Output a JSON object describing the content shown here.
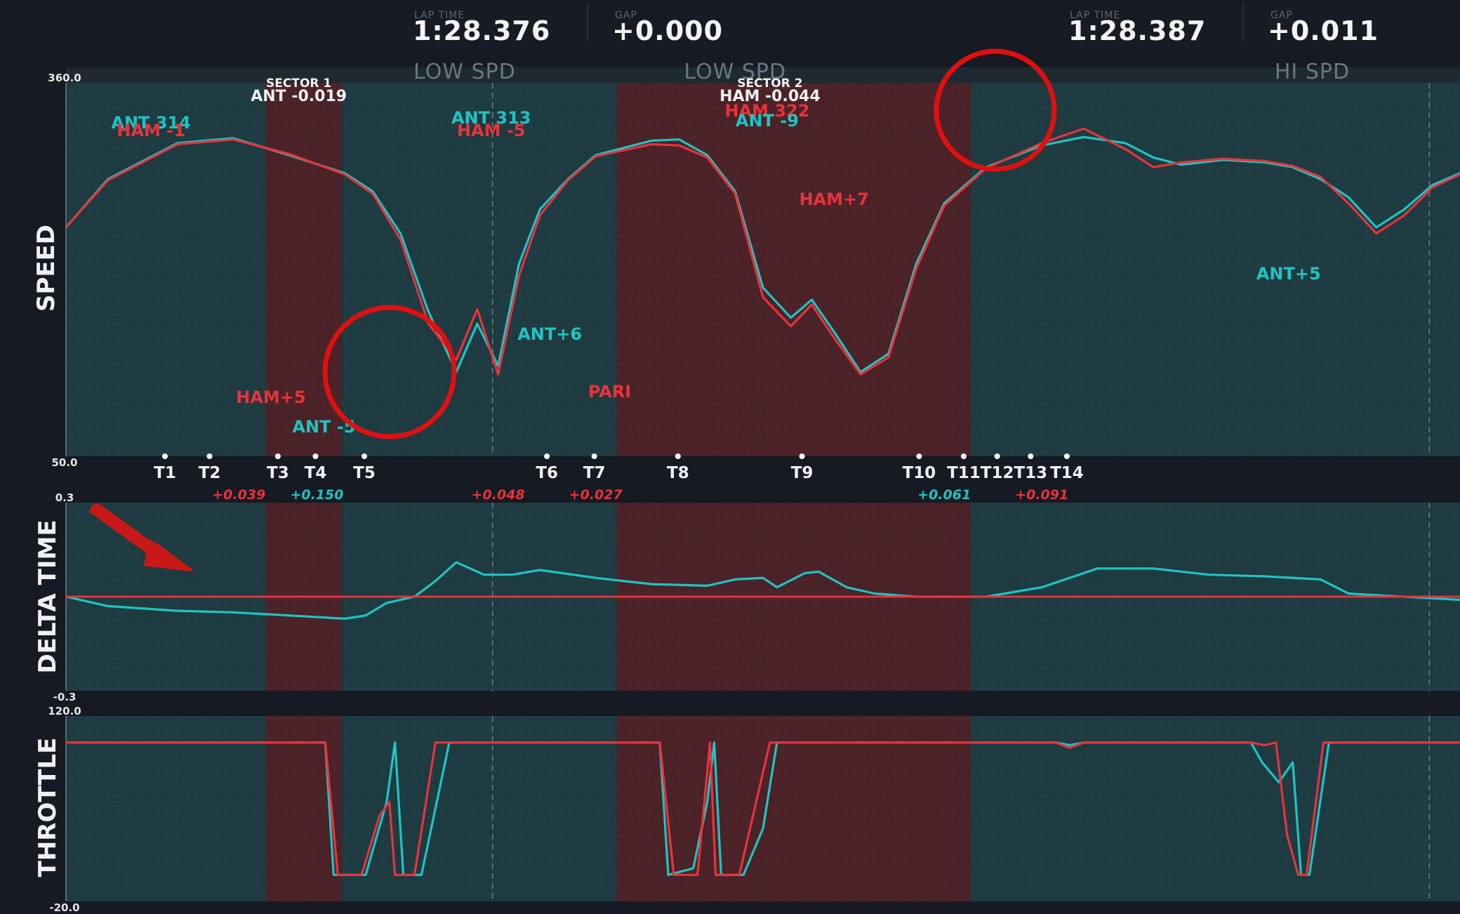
{
  "header": {
    "car1": {
      "lap_time_caption": "LAP TIME",
      "lap_time": "1:28.376",
      "gap_caption": "GAP",
      "gap": "+0.000"
    },
    "car2": {
      "lap_time_caption": "LAP TIME",
      "lap_time": "1:28.387",
      "gap_caption": "GAP",
      "gap": "+0.011"
    }
  },
  "zones": [
    {
      "label": "LOW SPD"
    },
    {
      "label": "LOW SPD"
    },
    {
      "label": "HI SPD"
    }
  ],
  "sector_labels": [
    {
      "title": "SECTOR 1",
      "value": "ANT -0.019"
    },
    {
      "title": "SECTOR 2",
      "value": "HAM -0.044"
    }
  ],
  "colors": {
    "ant": "#1fc4c4",
    "ham": "#e8333b",
    "teal_bg": "#1d3b40",
    "red_bg": "#4a2227",
    "circle": "#e01010",
    "arrow": "#c81818"
  },
  "panels": {
    "speed": {
      "label": "SPEED",
      "ymax_label": "360.0",
      "ymin_label": "50.0"
    },
    "delta": {
      "label": "DELTA TIME",
      "ymax_label": "0.3",
      "ymin_label": "-0.3"
    },
    "throttle": {
      "label": "THROTTLE",
      "ymax_label": "120.0",
      "ymin_label": "-20.0"
    }
  },
  "turns": [
    "T1",
    "T2",
    "T3",
    "T4",
    "T5",
    "T6",
    "T7",
    "T8",
    "T9",
    "T10",
    "T11",
    "T12",
    "T13",
    "T14"
  ],
  "gaps": [
    "+0.039",
    "+0.150",
    "+0.048",
    "+0.027",
    "+0.061",
    "+0.091"
  ],
  "annotations": [
    {
      "text": "ANT 314",
      "color": "ant"
    },
    {
      "text": "HAM -1",
      "color": "ham"
    },
    {
      "text": "ANT 313",
      "color": "ant"
    },
    {
      "text": "HAM -5",
      "color": "ham"
    },
    {
      "text": "HAM 322",
      "color": "ham"
    },
    {
      "text": "ANT -9",
      "color": "ant"
    },
    {
      "text": "HAM+7",
      "color": "ham"
    },
    {
      "text": "HAM+5",
      "color": "ham"
    },
    {
      "text": "ANT -5",
      "color": "ant"
    },
    {
      "text": "ANT+6",
      "color": "ant"
    },
    {
      "text": "PARI",
      "color": "ham"
    },
    {
      "text": "ANT+5",
      "color": "ant"
    }
  ],
  "chart_data": [
    {
      "type": "line",
      "title": "SPEED",
      "ylim": [
        50,
        360
      ],
      "xlim": [
        0,
        100
      ],
      "series": [
        {
          "name": "ANT",
          "points": [
            [
              0,
              240
            ],
            [
              3,
              280
            ],
            [
              8,
              310
            ],
            [
              12,
              314
            ],
            [
              16,
              300
            ],
            [
              20,
              285
            ],
            [
              22,
              270
            ],
            [
              24,
              235
            ],
            [
              26,
              170
            ],
            [
              28,
              120
            ],
            [
              29.5,
              160
            ],
            [
              31,
              125
            ],
            [
              32.5,
              210
            ],
            [
              34,
              255
            ],
            [
              36,
              280
            ],
            [
              38,
              300
            ],
            [
              42,
              312
            ],
            [
              44,
              313
            ],
            [
              46,
              300
            ],
            [
              48,
              270
            ],
            [
              50,
              190
            ],
            [
              52,
              165
            ],
            [
              53.5,
              180
            ],
            [
              55,
              155
            ],
            [
              57,
              120
            ],
            [
              59,
              135
            ],
            [
              61,
              210
            ],
            [
              63,
              260
            ],
            [
              66,
              290
            ],
            [
              70,
              308
            ],
            [
              73,
              315
            ],
            [
              76,
              310
            ],
            [
              78,
              298
            ],
            [
              80,
              292
            ],
            [
              83,
              296
            ],
            [
              86,
              294
            ],
            [
              88,
              290
            ],
            [
              90,
              280
            ],
            [
              92,
              265
            ],
            [
              94,
              240
            ],
            [
              96,
              255
            ],
            [
              98,
              275
            ],
            [
              100,
              285
            ]
          ]
        },
        {
          "name": "HAM",
          "points": [
            [
              0,
              240
            ],
            [
              3,
              279
            ],
            [
              8,
              309
            ],
            [
              12,
              313
            ],
            [
              16,
              301
            ],
            [
              20,
              284
            ],
            [
              22,
              268
            ],
            [
              24,
              230
            ],
            [
              26,
              160
            ],
            [
              28,
              130
            ],
            [
              29.5,
              172
            ],
            [
              31,
              118
            ],
            [
              32.5,
              200
            ],
            [
              34,
              250
            ],
            [
              36,
              279
            ],
            [
              38,
              299
            ],
            [
              42,
              309
            ],
            [
              44,
              308
            ],
            [
              46,
              298
            ],
            [
              48,
              268
            ],
            [
              50,
              182
            ],
            [
              52,
              158
            ],
            [
              53.5,
              176
            ],
            [
              55,
              150
            ],
            [
              57,
              118
            ],
            [
              59,
              132
            ],
            [
              61,
              206
            ],
            [
              63,
              258
            ],
            [
              66,
              289
            ],
            [
              70,
              310
            ],
            [
              73,
              322
            ],
            [
              76,
              305
            ],
            [
              78,
              290
            ],
            [
              80,
              294
            ],
            [
              83,
              297
            ],
            [
              86,
              295
            ],
            [
              88,
              291
            ],
            [
              90,
              282
            ],
            [
              92,
              260
            ],
            [
              94,
              235
            ],
            [
              96,
              250
            ],
            [
              98,
              273
            ],
            [
              100,
              284
            ]
          ]
        }
      ]
    },
    {
      "type": "line",
      "title": "DELTA TIME",
      "ylim": [
        -0.3,
        0.3
      ],
      "xlim": [
        0,
        100
      ],
      "series": [
        {
          "name": "ANT",
          "points": [
            [
              0,
              0
            ],
            [
              3,
              -0.03
            ],
            [
              8,
              -0.045
            ],
            [
              12,
              -0.05
            ],
            [
              18,
              -0.065
            ],
            [
              20,
              -0.07
            ],
            [
              21.5,
              -0.06
            ],
            [
              23,
              -0.02
            ],
            [
              25,
              0.0
            ],
            [
              26.5,
              0.05
            ],
            [
              28,
              0.11
            ],
            [
              29,
              0.09
            ],
            [
              30,
              0.07
            ],
            [
              32,
              0.07
            ],
            [
              34,
              0.085
            ],
            [
              38,
              0.06
            ],
            [
              42,
              0.04
            ],
            [
              46,
              0.035
            ],
            [
              48,
              0.055
            ],
            [
              50,
              0.06
            ],
            [
              51,
              0.03
            ],
            [
              53,
              0.075
            ],
            [
              54,
              0.08
            ],
            [
              56,
              0.03
            ],
            [
              58,
              0.01
            ],
            [
              61,
              0.0
            ],
            [
              66,
              0.0
            ],
            [
              70,
              0.03
            ],
            [
              74,
              0.09
            ],
            [
              78,
              0.09
            ],
            [
              82,
              0.07
            ],
            [
              86,
              0.065
            ],
            [
              90,
              0.055
            ],
            [
              92,
              0.01
            ],
            [
              94,
              0.005
            ],
            [
              100,
              -0.01
            ]
          ]
        },
        {
          "name": "HAM",
          "points": [
            [
              0,
              0
            ],
            [
              100,
              0
            ]
          ]
        }
      ]
    },
    {
      "type": "line",
      "title": "THROTTLE",
      "ylim": [
        -20,
        120
      ],
      "xlim": [
        0,
        100
      ],
      "series": [
        {
          "name": "ANT",
          "points": [
            [
              0,
              100
            ],
            [
              18,
              100
            ],
            [
              18.6,
              100
            ],
            [
              19.2,
              0
            ],
            [
              21.5,
              0
            ],
            [
              23,
              55
            ],
            [
              23.6,
              100
            ],
            [
              24.2,
              0
            ],
            [
              25.5,
              0
            ],
            [
              27.5,
              100
            ],
            [
              42,
              100
            ],
            [
              42.6,
              100
            ],
            [
              43.2,
              0
            ],
            [
              45,
              5
            ],
            [
              46,
              55
            ],
            [
              46.5,
              100
            ],
            [
              47,
              0
            ],
            [
              48.6,
              0
            ],
            [
              50,
              35
            ],
            [
              51,
              100
            ],
            [
              71,
              100
            ],
            [
              72,
              98
            ],
            [
              73,
              100
            ],
            [
              85,
              100
            ],
            [
              85.8,
              85
            ],
            [
              87,
              70
            ],
            [
              88,
              85
            ],
            [
              88.6,
              0
            ],
            [
              89.2,
              0
            ],
            [
              90.6,
              100
            ],
            [
              100,
              100
            ]
          ]
        },
        {
          "name": "HAM",
          "points": [
            [
              0,
              100
            ],
            [
              18,
              100
            ],
            [
              18.6,
              100
            ],
            [
              19.5,
              0
            ],
            [
              21.2,
              0
            ],
            [
              22.5,
              45
            ],
            [
              23.2,
              55
            ],
            [
              23.6,
              0
            ],
            [
              25,
              0
            ],
            [
              26.5,
              100
            ],
            [
              42,
              100
            ],
            [
              42.6,
              100
            ],
            [
              43.6,
              0
            ],
            [
              45.3,
              0
            ],
            [
              46.2,
              100
            ],
            [
              46.6,
              0
            ],
            [
              48.3,
              0
            ],
            [
              50.5,
              100
            ],
            [
              71,
              100
            ],
            [
              72,
              96
            ],
            [
              73,
              100
            ],
            [
              85,
              100
            ],
            [
              86,
              98
            ],
            [
              86.8,
              100
            ],
            [
              87.6,
              30
            ],
            [
              88.4,
              0
            ],
            [
              89,
              0
            ],
            [
              90.2,
              100
            ],
            [
              100,
              100
            ]
          ]
        }
      ]
    }
  ]
}
